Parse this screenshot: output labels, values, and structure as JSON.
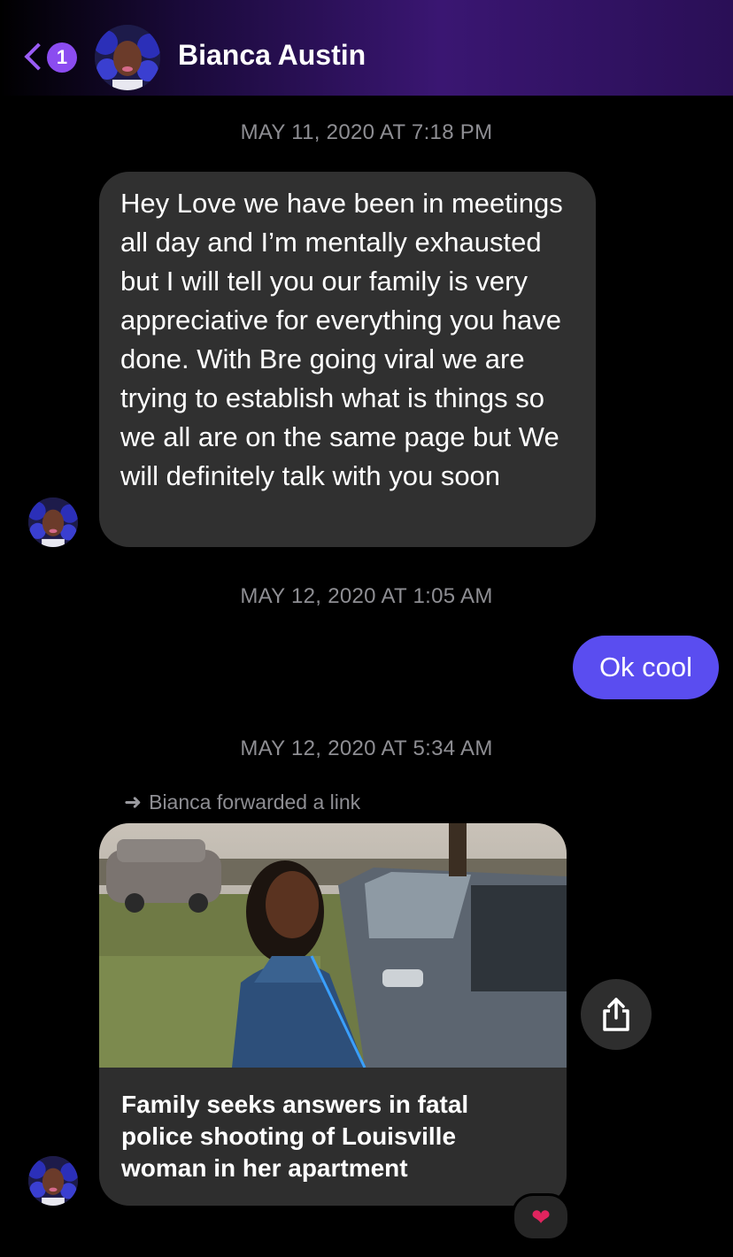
{
  "header": {
    "unread_count": "1",
    "contact_name": "Bianca Austin"
  },
  "thread": {
    "ts1": "MAY 11, 2020 AT 7:18 PM",
    "msg1": "Hey Love we have been in meetings all day and I’m mentally exhausted but I will tell you our family is very appreciative for everything you have done. With Bre going viral we are trying to establish what is things so we all are on the same page but We will definitely talk with you soon",
    "ts2": "MAY 12, 2020 AT 1:05 AM",
    "msg2": "Ok cool",
    "ts3": "MAY 12, 2020 AT 5:34 AM",
    "forward_note": "Bianca forwarded a link",
    "link_title": "Family seeks answers in fatal police shooting of Louisville woman in her apartment",
    "reaction": "❤"
  },
  "icons": {
    "back": "chevron-left-icon",
    "share": "share-icon",
    "forward": "arrow-right-icon",
    "reaction": "heart-icon"
  },
  "colors": {
    "accent": "#8b4cf0",
    "outgoing_bubble": "#5a4df0",
    "incoming_bubble": "#303030",
    "timestamp": "#8e8e93"
  }
}
